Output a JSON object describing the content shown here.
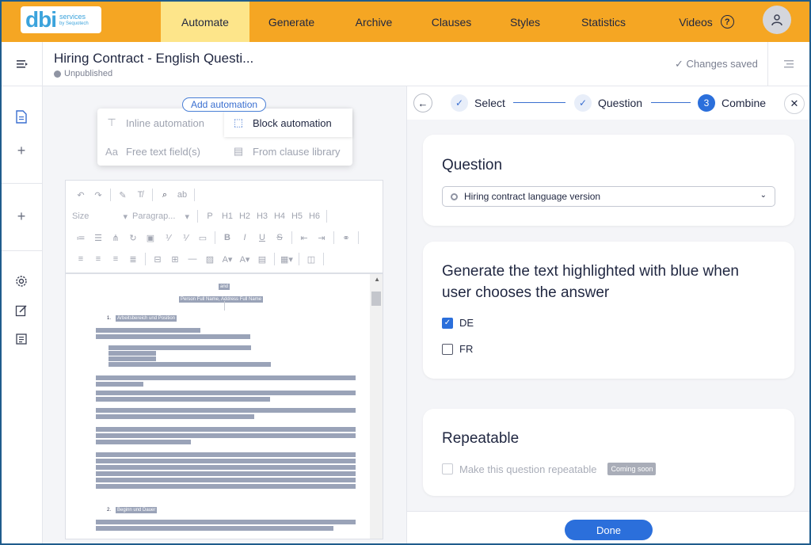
{
  "logo": {
    "big": "dbi",
    "line1": "services",
    "line2": "by Sequotech"
  },
  "topnav": {
    "items": [
      "Automate",
      "Generate",
      "Archive",
      "Clauses",
      "Styles",
      "Statistics",
      "Videos"
    ],
    "active": "Automate",
    "help_icon": "?"
  },
  "header": {
    "title": "Hiring Contract - English Questi...",
    "status": "Unpublished",
    "saved": "Changes saved"
  },
  "editor": {
    "add_automation": "Add automation",
    "menu": {
      "inline": "Inline automation",
      "block": "Block automation",
      "free_text": "Free text field(s)",
      "clause_library": "From clause library"
    },
    "toolbar": {
      "size": "Size",
      "paragraph": "Paragrap...",
      "headings": [
        "P",
        "H1",
        "H2",
        "H3",
        "H4",
        "H5",
        "H6"
      ],
      "format": [
        "B",
        "I",
        "U",
        "S"
      ]
    },
    "document": {
      "top_label": "and",
      "subtitle": "Person Full Name, Address Full Name",
      "section1": "1.",
      "section2": "2.",
      "section2_title": "Beginn und Dauer",
      "section1_title": "Arbeitsbereich und Position"
    }
  },
  "panel": {
    "steps": [
      {
        "label": "Select",
        "state": "done",
        "mark": "✓"
      },
      {
        "label": "Question",
        "state": "done",
        "mark": "✓"
      },
      {
        "label": "Combine",
        "state": "current",
        "mark": "3"
      }
    ],
    "question_card": {
      "title": "Question",
      "selected": "Hiring contract language version"
    },
    "generate_card": {
      "title_line1": "Generate the text highlighted with blue when",
      "title_line2": "user chooses the answer",
      "options": [
        {
          "label": "DE",
          "checked": true
        },
        {
          "label": "FR",
          "checked": false
        }
      ]
    },
    "repeat_card": {
      "title": "Repeatable",
      "checkbox_label": "Make this question repeatable",
      "badge": "Coming soon"
    },
    "done": "Done"
  },
  "colors": {
    "nav": "#f5a623",
    "nav_active": "#fde58a",
    "accent": "#2b6fdb",
    "frame": "#1f5c8c"
  }
}
